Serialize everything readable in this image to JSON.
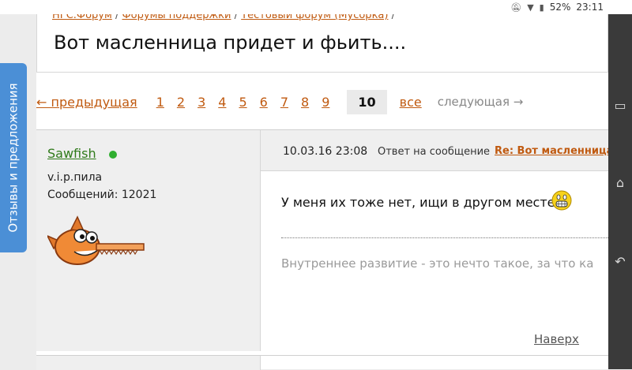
{
  "status_bar": {
    "battery": "52%",
    "time": "23:11"
  },
  "feedback_tab": "Отзывы и предложения",
  "breadcrumb": {
    "items": [
      "НГС.Форум",
      "Форумы поддержки",
      "Тестовый форум (Мусорка)"
    ],
    "separator": "/"
  },
  "topic_title": "Вот масленница придет и фьить....",
  "pagination": {
    "prev": "← предыдущая",
    "pages": [
      "1",
      "2",
      "3",
      "4",
      "5",
      "6",
      "7",
      "8",
      "9"
    ],
    "current": "10",
    "all": "все",
    "next": "следующая →"
  },
  "post": {
    "author": "Sawfish",
    "rank": "v.i.p.пила",
    "messages": "Сообщений: 12021",
    "date": "10.03.16 23:08",
    "reply_prefix": "Ответ на сообщение",
    "reply_link": "Re: Вот масленница",
    "body": "У меня их тоже нет, ищи в другом месте",
    "signature": "Внутреннее развитие - это нечто такое, за что ка",
    "to_top": "Наверх"
  },
  "colors": {
    "link": "#c05a10",
    "author": "#2f7a1a",
    "online": "#2fae2f",
    "feedback_bg": "#4b8fd6"
  }
}
